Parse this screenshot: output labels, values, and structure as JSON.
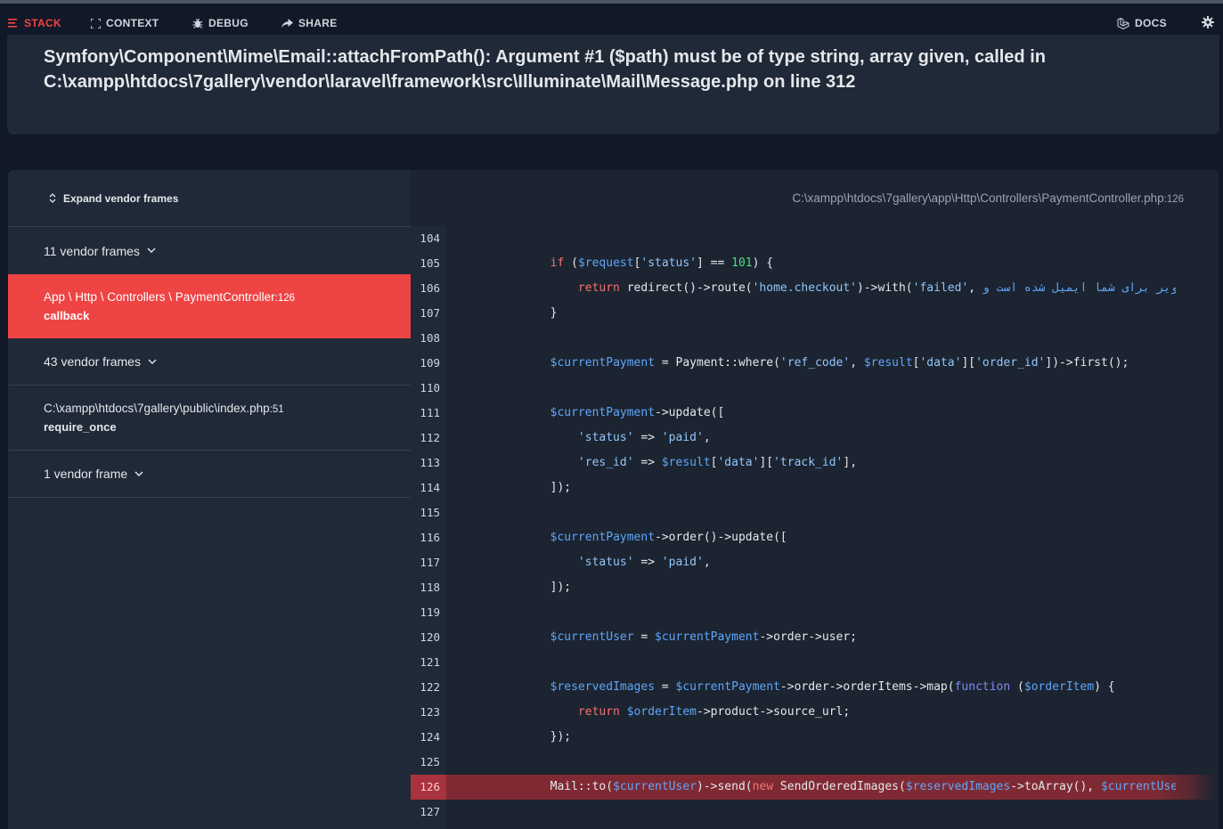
{
  "nav": {
    "stack": "STACK",
    "context": "CONTEXT",
    "debug": "DEBUG",
    "share": "SHARE",
    "docs": "DOCS"
  },
  "exception": {
    "message": "Symfony\\Component\\Mime\\Email::attachFromPath(): Argument #1 ($path) must be of type string, array given, called in C:\\xampp\\htdocs\\7gallery\\vendor\\laravel\\framework\\src\\Illuminate\\Mail\\Message.php on line 312"
  },
  "frames": {
    "expand_label": "Expand vendor frames",
    "vendor_1": "11 vendor frames",
    "app_frame_path": "App \\ Http \\ Controllers \\ PaymentController",
    "app_frame_line": "126",
    "app_frame_fn": "callback",
    "vendor_2": "43 vendor frames",
    "file_frame_path": "C:\\xampp\\htdocs\\7gallery\\public\\index.php",
    "file_frame_line": "51",
    "file_frame_fn": "require_once",
    "vendor_3": "1 vendor frame"
  },
  "code": {
    "file_path": "C:\\xampp\\htdocs\\7gallery\\app\\Http\\Controllers\\PaymentController.php",
    "file_line": "126",
    "highlight_line": 126,
    "lines": [
      {
        "n": "104",
        "tokens": []
      },
      {
        "n": "105",
        "tokens": [
          [
            "        ",
            ""
          ],
          [
            "if",
            "kw"
          ],
          [
            " (",
            ""
          ],
          [
            "$request",
            "var"
          ],
          [
            "[",
            ""
          ],
          [
            "'status'",
            "str"
          ],
          [
            "] == ",
            ""
          ],
          [
            "101",
            "num"
          ],
          [
            ") {",
            ""
          ]
        ]
      },
      {
        "n": "106",
        "tokens": [
          [
            "            ",
            ""
          ],
          [
            "return",
            "kw"
          ],
          [
            " redirect()->route(",
            ""
          ],
          [
            "'home.checkout'",
            "str"
          ],
          [
            ")->with(",
            ""
          ],
          [
            "'failed'",
            "str"
          ],
          [
            ", ",
            ""
          ],
          [
            "'تصاویر برای شما ایمیل شده است و",
            "rtl"
          ]
        ]
      },
      {
        "n": "107",
        "tokens": [
          [
            "        }",
            ""
          ]
        ]
      },
      {
        "n": "108",
        "tokens": []
      },
      {
        "n": "109",
        "tokens": [
          [
            "        ",
            ""
          ],
          [
            "$currentPayment",
            "var"
          ],
          [
            " = Payment::where(",
            ""
          ],
          [
            "'ref_code'",
            "str"
          ],
          [
            ", ",
            ""
          ],
          [
            "$result",
            "var"
          ],
          [
            "[",
            ""
          ],
          [
            "'data'",
            "str"
          ],
          [
            "][",
            ""
          ],
          [
            "'order_id'",
            "str"
          ],
          [
            "])->first();",
            ""
          ]
        ]
      },
      {
        "n": "110",
        "tokens": []
      },
      {
        "n": "111",
        "tokens": [
          [
            "        ",
            ""
          ],
          [
            "$currentPayment",
            "var"
          ],
          [
            "->update([",
            ""
          ]
        ]
      },
      {
        "n": "112",
        "tokens": [
          [
            "            ",
            ""
          ],
          [
            "'status'",
            "str"
          ],
          [
            " => ",
            ""
          ],
          [
            "'paid'",
            "str"
          ],
          [
            ",",
            ""
          ]
        ]
      },
      {
        "n": "113",
        "tokens": [
          [
            "            ",
            ""
          ],
          [
            "'res_id'",
            "str"
          ],
          [
            " => ",
            ""
          ],
          [
            "$result",
            "var"
          ],
          [
            "[",
            ""
          ],
          [
            "'data'",
            "str"
          ],
          [
            "][",
            ""
          ],
          [
            "'track_id'",
            "str"
          ],
          [
            "],",
            ""
          ]
        ]
      },
      {
        "n": "114",
        "tokens": [
          [
            "        ]);",
            ""
          ]
        ]
      },
      {
        "n": "115",
        "tokens": []
      },
      {
        "n": "116",
        "tokens": [
          [
            "        ",
            ""
          ],
          [
            "$currentPayment",
            "var"
          ],
          [
            "->order()->update([",
            ""
          ]
        ]
      },
      {
        "n": "117",
        "tokens": [
          [
            "            ",
            ""
          ],
          [
            "'status'",
            "str"
          ],
          [
            " => ",
            ""
          ],
          [
            "'paid'",
            "str"
          ],
          [
            ",",
            ""
          ]
        ]
      },
      {
        "n": "118",
        "tokens": [
          [
            "        ]);",
            ""
          ]
        ]
      },
      {
        "n": "119",
        "tokens": []
      },
      {
        "n": "120",
        "tokens": [
          [
            "        ",
            ""
          ],
          [
            "$currentUser",
            "var"
          ],
          [
            " = ",
            ""
          ],
          [
            "$currentPayment",
            "var"
          ],
          [
            "->order->user;",
            ""
          ]
        ]
      },
      {
        "n": "121",
        "tokens": []
      },
      {
        "n": "122",
        "tokens": [
          [
            "        ",
            ""
          ],
          [
            "$reservedImages",
            "var"
          ],
          [
            " = ",
            ""
          ],
          [
            "$currentPayment",
            "var"
          ],
          [
            "->order->orderItems->map(",
            ""
          ],
          [
            "function",
            "kw2"
          ],
          [
            " (",
            ""
          ],
          [
            "$orderItem",
            "var"
          ],
          [
            ") {",
            ""
          ]
        ]
      },
      {
        "n": "123",
        "tokens": [
          [
            "            ",
            ""
          ],
          [
            "return",
            "kw"
          ],
          [
            " ",
            ""
          ],
          [
            "$orderItem",
            "var"
          ],
          [
            "->product->source_url;",
            ""
          ]
        ]
      },
      {
        "n": "124",
        "tokens": [
          [
            "        });",
            ""
          ]
        ]
      },
      {
        "n": "125",
        "tokens": []
      },
      {
        "n": "126",
        "tokens": [
          [
            "        Mail::to(",
            ""
          ],
          [
            "$currentUser",
            "var"
          ],
          [
            ")->send(",
            ""
          ],
          [
            "new",
            "kw"
          ],
          [
            " SendOrderedImages(",
            ""
          ],
          [
            "$reservedImages",
            "var"
          ],
          [
            "->toArray(), ",
            ""
          ],
          [
            "$currentUser",
            "var"
          ],
          [
            "));",
            ""
          ]
        ]
      },
      {
        "n": "127",
        "tokens": []
      }
    ]
  },
  "colors": {
    "accent": "#ef4444",
    "background": "#111827",
    "card": "#1f2937",
    "highlight_line": "#7f2a33"
  }
}
